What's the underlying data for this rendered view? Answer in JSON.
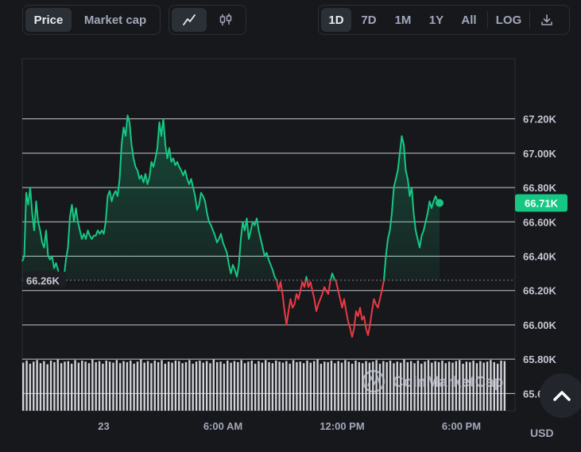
{
  "toolbar": {
    "metric_tabs": [
      {
        "label": "Price",
        "active": true
      },
      {
        "label": "Market cap",
        "active": false
      }
    ],
    "chart_style": [
      {
        "icon": "line-chart-icon",
        "active": true
      },
      {
        "icon": "candlestick-icon",
        "active": false
      }
    ],
    "ranges": [
      {
        "label": "1D",
        "active": true
      },
      {
        "label": "7D",
        "active": false
      },
      {
        "label": "1M",
        "active": false
      },
      {
        "label": "1Y",
        "active": false
      },
      {
        "label": "All",
        "active": false
      },
      {
        "label": "LOG",
        "active": false
      }
    ],
    "download_icon": "download-icon"
  },
  "watermark": "CoinMarketCap",
  "currency": "USD",
  "colors": {
    "up": "#16c784",
    "down": "#ea3943",
    "background": "#17181b",
    "current_label": "#16c784"
  },
  "chart_data": {
    "type": "line",
    "ylim": [
      65.5,
      67.55
    ],
    "yunit": "K",
    "yticks": [
      "67.20K",
      "67.00K",
      "66.80K",
      "66.60K",
      "66.40K",
      "66.20K",
      "66.00K",
      "65.80K",
      "65.60K"
    ],
    "ytick_values": [
      67.2,
      67.0,
      66.8,
      66.6,
      66.4,
      66.2,
      66.0,
      65.8,
      65.6
    ],
    "xticks": [
      "23",
      "6:00 AM",
      "12:00 PM",
      "6:00 PM"
    ],
    "xtick_hours": [
      0,
      6,
      12,
      18
    ],
    "x_range_hours": [
      -4.1,
      20.7
    ],
    "baseline": {
      "value": 66.26,
      "label": "66.26K"
    },
    "current": {
      "value": 66.71,
      "label": "66.71K"
    },
    "series": [
      {
        "points": [
          [
            -4.1,
            66.37
          ],
          [
            -4.0,
            66.4
          ],
          [
            -3.9,
            66.77
          ],
          [
            -3.8,
            66.7
          ],
          [
            -3.7,
            66.8
          ],
          [
            -3.6,
            66.65
          ],
          [
            -3.5,
            66.55
          ],
          [
            -3.4,
            66.72
          ],
          [
            -3.3,
            66.6
          ],
          [
            -3.2,
            66.55
          ],
          [
            -3.1,
            66.48
          ],
          [
            -3.0,
            66.45
          ],
          [
            -2.9,
            66.55
          ],
          [
            -2.8,
            66.4
          ],
          [
            -2.7,
            66.38
          ],
          [
            -2.6,
            66.4
          ],
          [
            -2.5,
            66.33
          ],
          [
            -2.4,
            66.36
          ],
          [
            -2.3,
            66.32
          ],
          [
            -2.2,
            66.26
          ],
          [
            -2.1,
            66.3
          ],
          [
            -2.0,
            66.28
          ],
          [
            -1.9,
            66.38
          ],
          [
            -1.8,
            66.45
          ],
          [
            -1.7,
            66.63
          ],
          [
            -1.6,
            66.7
          ],
          [
            -1.5,
            66.6
          ],
          [
            -1.4,
            66.68
          ],
          [
            -1.3,
            66.6
          ],
          [
            -1.2,
            66.55
          ],
          [
            -1.1,
            66.5
          ],
          [
            -1.0,
            66.53
          ],
          [
            -0.9,
            66.5
          ],
          [
            -0.8,
            66.55
          ],
          [
            -0.7,
            66.52
          ],
          [
            -0.6,
            66.5
          ],
          [
            -0.5,
            66.52
          ],
          [
            -0.4,
            66.52
          ],
          [
            -0.3,
            66.55
          ],
          [
            -0.2,
            66.53
          ],
          [
            -0.1,
            66.55
          ],
          [
            0.0,
            66.53
          ],
          [
            0.1,
            66.6
          ],
          [
            0.2,
            66.75
          ],
          [
            0.3,
            66.78
          ],
          [
            0.4,
            66.72
          ],
          [
            0.5,
            66.76
          ],
          [
            0.6,
            66.78
          ],
          [
            0.7,
            66.75
          ],
          [
            0.8,
            66.85
          ],
          [
            0.9,
            67.05
          ],
          [
            1.0,
            67.15
          ],
          [
            1.1,
            67.1
          ],
          [
            1.2,
            67.22
          ],
          [
            1.3,
            67.18
          ],
          [
            1.4,
            67.05
          ],
          [
            1.5,
            66.97
          ],
          [
            1.6,
            66.92
          ],
          [
            1.7,
            66.9
          ],
          [
            1.8,
            66.85
          ],
          [
            1.9,
            66.87
          ],
          [
            2.0,
            66.83
          ],
          [
            2.1,
            66.88
          ],
          [
            2.2,
            66.82
          ],
          [
            2.3,
            66.86
          ],
          [
            2.4,
            66.95
          ],
          [
            2.5,
            66.92
          ],
          [
            2.6,
            66.97
          ],
          [
            2.7,
            67.03
          ],
          [
            2.8,
            67.18
          ],
          [
            2.9,
            67.1
          ],
          [
            3.0,
            67.2
          ],
          [
            3.1,
            67.05
          ],
          [
            3.2,
            66.97
          ],
          [
            3.3,
            67.03
          ],
          [
            3.4,
            66.95
          ],
          [
            3.5,
            66.97
          ],
          [
            3.6,
            66.93
          ],
          [
            3.7,
            66.95
          ],
          [
            3.8,
            66.92
          ],
          [
            3.9,
            66.9
          ],
          [
            4.0,
            66.87
          ],
          [
            4.1,
            66.9
          ],
          [
            4.2,
            66.85
          ],
          [
            4.3,
            66.82
          ],
          [
            4.4,
            66.85
          ],
          [
            4.5,
            66.8
          ],
          [
            4.6,
            66.75
          ],
          [
            4.7,
            66.67
          ],
          [
            4.8,
            66.7
          ],
          [
            4.9,
            66.77
          ],
          [
            5.0,
            66.75
          ],
          [
            5.1,
            66.72
          ],
          [
            5.2,
            66.65
          ],
          [
            5.3,
            66.6
          ],
          [
            5.4,
            66.58
          ],
          [
            5.5,
            66.55
          ],
          [
            5.6,
            66.52
          ],
          [
            5.7,
            66.48
          ],
          [
            5.8,
            66.5
          ],
          [
            5.9,
            66.53
          ],
          [
            6.0,
            66.48
          ],
          [
            6.1,
            66.45
          ],
          [
            6.2,
            66.42
          ],
          [
            6.3,
            66.35
          ],
          [
            6.4,
            66.3
          ],
          [
            6.5,
            66.35
          ],
          [
            6.6,
            66.32
          ],
          [
            6.7,
            66.28
          ],
          [
            6.8,
            66.35
          ],
          [
            6.9,
            66.5
          ],
          [
            7.0,
            66.6
          ],
          [
            7.1,
            66.55
          ],
          [
            7.2,
            66.62
          ],
          [
            7.3,
            66.5
          ],
          [
            7.4,
            66.55
          ],
          [
            7.5,
            66.6
          ],
          [
            7.6,
            66.58
          ],
          [
            7.7,
            66.62
          ],
          [
            7.8,
            66.55
          ],
          [
            7.9,
            66.5
          ],
          [
            8.0,
            66.45
          ],
          [
            8.1,
            66.4
          ],
          [
            8.2,
            66.42
          ],
          [
            8.3,
            66.38
          ],
          [
            8.4,
            66.35
          ],
          [
            8.5,
            66.32
          ],
          [
            8.6,
            66.28
          ],
          [
            8.7,
            66.26
          ],
          [
            8.8,
            66.2
          ],
          [
            8.9,
            66.25
          ],
          [
            9.0,
            66.18
          ],
          [
            9.1,
            66.08
          ],
          [
            9.2,
            66.0
          ],
          [
            9.3,
            66.08
          ],
          [
            9.4,
            66.15
          ],
          [
            9.5,
            66.1
          ],
          [
            9.6,
            66.12
          ],
          [
            9.7,
            66.18
          ],
          [
            9.8,
            66.15
          ],
          [
            9.9,
            66.2
          ],
          [
            10.0,
            66.25
          ],
          [
            10.1,
            66.22
          ],
          [
            10.2,
            66.28
          ],
          [
            10.3,
            66.22
          ],
          [
            10.4,
            66.25
          ],
          [
            10.5,
            66.2
          ],
          [
            10.6,
            66.15
          ],
          [
            10.7,
            66.08
          ],
          [
            10.8,
            66.12
          ],
          [
            10.9,
            66.15
          ],
          [
            11.0,
            66.18
          ],
          [
            11.1,
            66.22
          ],
          [
            11.2,
            66.2
          ],
          [
            11.3,
            66.18
          ],
          [
            11.4,
            66.25
          ],
          [
            11.5,
            66.3
          ],
          [
            11.6,
            66.27
          ],
          [
            11.7,
            66.25
          ],
          [
            11.8,
            66.2
          ],
          [
            11.9,
            66.15
          ],
          [
            12.0,
            66.1
          ],
          [
            12.1,
            66.15
          ],
          [
            12.2,
            66.08
          ],
          [
            12.3,
            66.02
          ],
          [
            12.4,
            65.98
          ],
          [
            12.5,
            65.93
          ],
          [
            12.6,
            65.98
          ],
          [
            12.7,
            66.08
          ],
          [
            12.8,
            66.05
          ],
          [
            12.9,
            66.1
          ],
          [
            13.0,
            66.03
          ],
          [
            13.1,
            66.05
          ],
          [
            13.2,
            65.98
          ],
          [
            13.3,
            65.94
          ],
          [
            13.4,
            66.0
          ],
          [
            13.5,
            66.08
          ],
          [
            13.6,
            66.15
          ],
          [
            13.7,
            66.12
          ],
          [
            13.8,
            66.1
          ],
          [
            13.9,
            66.15
          ],
          [
            14.0,
            66.2
          ],
          [
            14.1,
            66.26
          ],
          [
            14.2,
            66.4
          ],
          [
            14.3,
            66.5
          ],
          [
            14.4,
            66.55
          ],
          [
            14.5,
            66.65
          ],
          [
            14.6,
            66.8
          ],
          [
            14.7,
            66.85
          ],
          [
            14.8,
            66.9
          ],
          [
            14.9,
            67.0
          ],
          [
            15.0,
            67.1
          ],
          [
            15.1,
            67.05
          ],
          [
            15.2,
            66.9
          ],
          [
            15.3,
            66.85
          ],
          [
            15.4,
            66.75
          ],
          [
            15.5,
            66.8
          ],
          [
            15.6,
            66.65
          ],
          [
            15.7,
            66.55
          ],
          [
            15.8,
            66.5
          ],
          [
            15.9,
            66.45
          ],
          [
            16.0,
            66.52
          ],
          [
            16.1,
            66.55
          ],
          [
            16.2,
            66.6
          ],
          [
            16.3,
            66.65
          ],
          [
            16.4,
            66.72
          ],
          [
            16.5,
            66.68
          ],
          [
            16.6,
            66.72
          ],
          [
            16.7,
            66.75
          ],
          [
            16.8,
            66.72
          ],
          [
            16.9,
            66.71
          ]
        ]
      }
    ],
    "volume": [
      0.93,
      0.97,
      0.91,
      0.95,
      0.98,
      0.92,
      0.96,
      0.9,
      0.97,
      0.94,
      0.99,
      0.92,
      0.95,
      0.96,
      0.91,
      0.98,
      0.93,
      0.97,
      0.95,
      0.92,
      0.99,
      0.94,
      0.96,
      0.91,
      0.97,
      0.95,
      0.93,
      0.98,
      0.92,
      0.96,
      0.94,
      0.97,
      0.91,
      0.95,
      0.99,
      0.93,
      0.96,
      0.92,
      0.97,
      0.94,
      0.98,
      0.91,
      0.95,
      0.93,
      0.97,
      0.96,
      0.92,
      0.94,
      0.98,
      0.91,
      0.95,
      0.97,
      0.93,
      0.96,
      0.92,
      0.99,
      0.94,
      0.95,
      0.91,
      0.97,
      0.93,
      0.96,
      0.94,
      0.98,
      0.92,
      0.95,
      0.97,
      0.91,
      0.96,
      0.93,
      0.98,
      0.94,
      0.92,
      0.97,
      0.95,
      0.93,
      0.96,
      0.91,
      0.98,
      0.94,
      0.95,
      0.92,
      0.97,
      0.93,
      0.96,
      0.99,
      0.91,
      0.95,
      0.94,
      0.97,
      0.92,
      0.96,
      0.93,
      0.98,
      0.95,
      0.91,
      0.97,
      0.94,
      0.92,
      0.96,
      0.93,
      0.95,
      0.98,
      0.91,
      0.96,
      0.94,
      0.97,
      0.92,
      0.95,
      0.93,
      0.99,
      0.94,
      0.96,
      0.92,
      0.97,
      0.91,
      0.95,
      0.98,
      0.93,
      0.96,
      0.94,
      0.97,
      0.92,
      0.95,
      0.93,
      0.96,
      0.98,
      0.91,
      0.95,
      0.94,
      0.97,
      0.92,
      0.96,
      0.93,
      0.95,
      0.98,
      0.94,
      0.91,
      0.97,
      0.96
    ]
  }
}
